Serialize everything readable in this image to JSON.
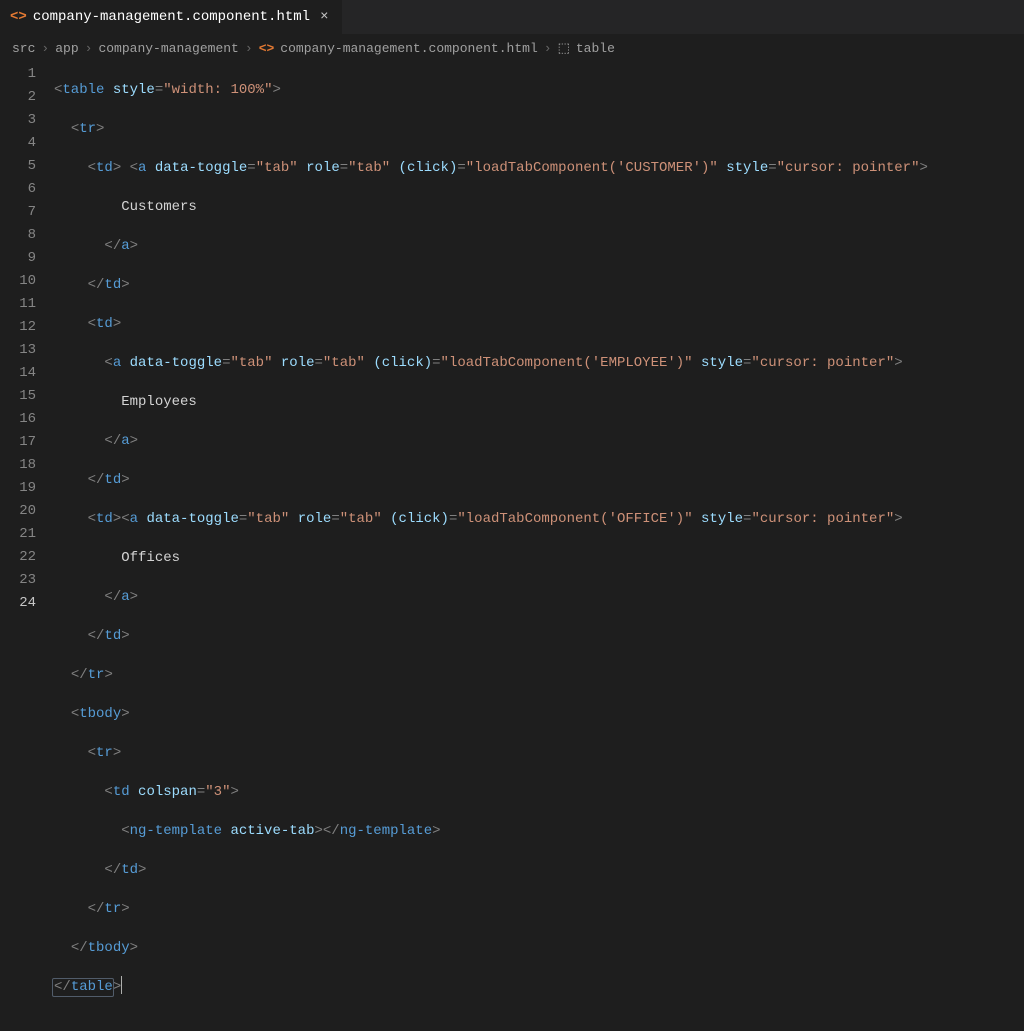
{
  "tab": {
    "filename": "company-management.component.html",
    "close_glyph": "×"
  },
  "breadcrumb": {
    "p1": "src",
    "p2": "app",
    "p3": "company-management",
    "p4": "company-management.component.html",
    "p5": "table"
  },
  "gutter": {
    "lines": [
      "1",
      "2",
      "3",
      "4",
      "5",
      "6",
      "7",
      "8",
      "9",
      "10",
      "11",
      "12",
      "13",
      "14",
      "15",
      "16",
      "17",
      "18",
      "19",
      "20",
      "21",
      "22",
      "23",
      "24"
    ],
    "active": "24"
  },
  "code": {
    "l1": {
      "t1": "table",
      "a1": "style",
      "v1": "\"width: 100%\""
    },
    "l2": {
      "t": "tr"
    },
    "l3": {
      "t1": "td",
      "t2": "a",
      "a1": "data-toggle",
      "v1": "\"tab\"",
      "a2": "role",
      "v2": "\"tab\"",
      "a3": "(click)",
      "v3": "\"loadTabComponent('CUSTOMER')\"",
      "a4": "style",
      "v4": "\"cursor: pointer\""
    },
    "l4": {
      "txt": "Customers"
    },
    "l5": {
      "t": "a"
    },
    "l6": {
      "t": "td"
    },
    "l7": {
      "t": "td"
    },
    "l8": {
      "t": "a",
      "a1": "data-toggle",
      "v1": "\"tab\"",
      "a2": "role",
      "v2": "\"tab\"",
      "a3": "(click)",
      "v3": "\"loadTabComponent('EMPLOYEE')\"",
      "a4": "style",
      "v4": "\"cursor: pointer\""
    },
    "l9": {
      "txt": "Employees"
    },
    "l10": {
      "t": "a"
    },
    "l11": {
      "t": "td"
    },
    "l12": {
      "t1": "td",
      "t2": "a",
      "a1": "data-toggle",
      "v1": "\"tab\"",
      "a2": "role",
      "v2": "\"tab\"",
      "a3": "(click)",
      "v3": "\"loadTabComponent('OFFICE')\"",
      "a4": "style",
      "v4": "\"cursor: pointer\""
    },
    "l13": {
      "txt": "Offices"
    },
    "l14": {
      "t": "a"
    },
    "l15": {
      "t": "td"
    },
    "l16": {
      "t": "tr"
    },
    "l17": {
      "t": "tbody"
    },
    "l18": {
      "t": "tr"
    },
    "l19": {
      "t": "td",
      "a1": "colspan",
      "v1": "\"3\""
    },
    "l20": {
      "t": "ng-template",
      "a1": "active-tab",
      "t2": "ng-template"
    },
    "l21": {
      "t": "td"
    },
    "l22": {
      "t": "tr"
    },
    "l23": {
      "t": "tbody"
    },
    "l24": {
      "t": "table"
    }
  }
}
